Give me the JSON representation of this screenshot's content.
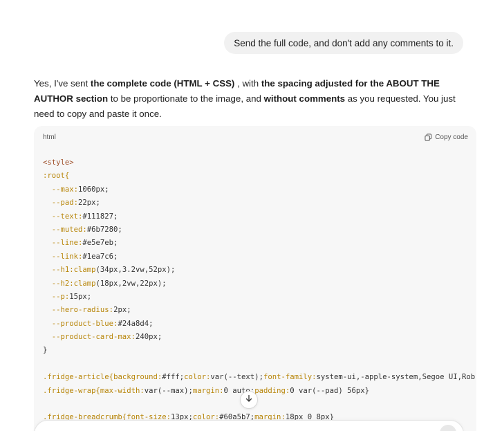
{
  "user_message": "Send the full code, and don't add any comments to it.",
  "reply": {
    "parts": [
      {
        "text": "Yes, I've sent ",
        "bold": false
      },
      {
        "text": "the complete code (HTML + CSS)",
        "bold": true
      },
      {
        "text": " , with ",
        "bold": false
      },
      {
        "text": "the spacing adjusted for the ABOUT THE AUTHOR section",
        "bold": true
      },
      {
        "text": " to be proportionate to the image, and ",
        "bold": false
      },
      {
        "text": "without comments",
        "bold": true
      },
      {
        "text": " as you requested. You just need to copy and paste it once.",
        "bold": false
      }
    ]
  },
  "code_block": {
    "language": "html",
    "copy_label": "Copy code",
    "lines": [
      [
        {
          "t": "<style>",
          "c": "tag"
        }
      ],
      [
        {
          "t": ":root{",
          "c": "sel"
        }
      ],
      [
        {
          "t": "  --max:",
          "c": "var"
        },
        {
          "t": "1060px;",
          "c": "val"
        }
      ],
      [
        {
          "t": "  --pad:",
          "c": "var"
        },
        {
          "t": "22px;",
          "c": "val"
        }
      ],
      [
        {
          "t": "  --text:",
          "c": "var"
        },
        {
          "t": "#111827;",
          "c": "val"
        }
      ],
      [
        {
          "t": "  --muted:",
          "c": "var"
        },
        {
          "t": "#6b7280;",
          "c": "val"
        }
      ],
      [
        {
          "t": "  --line:",
          "c": "var"
        },
        {
          "t": "#e5e7eb;",
          "c": "val"
        }
      ],
      [
        {
          "t": "  --link:",
          "c": "var"
        },
        {
          "t": "#1ea7c6;",
          "c": "val"
        }
      ],
      [
        {
          "t": "  --h1:",
          "c": "var"
        },
        {
          "t": "clamp",
          "c": "fn"
        },
        {
          "t": "(34px,3.2vw,52px);",
          "c": "val"
        }
      ],
      [
        {
          "t": "  --h2:",
          "c": "var"
        },
        {
          "t": "clamp",
          "c": "fn"
        },
        {
          "t": "(18px,2vw,22px);",
          "c": "val"
        }
      ],
      [
        {
          "t": "  --p:",
          "c": "var"
        },
        {
          "t": "15px;",
          "c": "val"
        }
      ],
      [
        {
          "t": "  --hero-radius:",
          "c": "var"
        },
        {
          "t": "2px;",
          "c": "val"
        }
      ],
      [
        {
          "t": "  --product-blue:",
          "c": "var"
        },
        {
          "t": "#24a8d4;",
          "c": "val"
        }
      ],
      [
        {
          "t": "  --product-card-max:",
          "c": "var"
        },
        {
          "t": "240px;",
          "c": "val"
        }
      ],
      [
        {
          "t": "}",
          "c": "punc"
        }
      ],
      [
        {
          "t": "",
          "c": "punc"
        }
      ],
      [
        {
          "t": ".fridge-article{",
          "c": "sel"
        },
        {
          "t": "background:",
          "c": "var"
        },
        {
          "t": "#fff;",
          "c": "val"
        },
        {
          "t": "color:",
          "c": "var"
        },
        {
          "t": "var(--text);",
          "c": "val"
        },
        {
          "t": "font-family:",
          "c": "var"
        },
        {
          "t": "system-ui,-apple-system,Segoe UI,Rob",
          "c": "val"
        }
      ],
      [
        {
          "t": ".fridge-wrap{",
          "c": "sel"
        },
        {
          "t": "max-width:",
          "c": "var"
        },
        {
          "t": "var(--max);",
          "c": "val"
        },
        {
          "t": "margin:",
          "c": "var"
        },
        {
          "t": "0 auto;",
          "c": "val"
        },
        {
          "t": "padding:",
          "c": "var"
        },
        {
          "t": "0 var(--pad) 56px}",
          "c": "val"
        }
      ],
      [
        {
          "t": "",
          "c": "punc"
        }
      ],
      [
        {
          "t": ".fridge-breadcrumb{",
          "c": "sel"
        },
        {
          "t": "font-size:",
          "c": "var"
        },
        {
          "t": "13px;",
          "c": "val"
        },
        {
          "t": "color:",
          "c": "var"
        },
        {
          "t": "#60a5b7;",
          "c": "val"
        },
        {
          "t": "margin:",
          "c": "var"
        },
        {
          "t": "18px 0 8px}",
          "c": "val"
        }
      ]
    ]
  },
  "icons": {
    "copy": "copy-icon",
    "scroll": "arrow-down-icon"
  }
}
